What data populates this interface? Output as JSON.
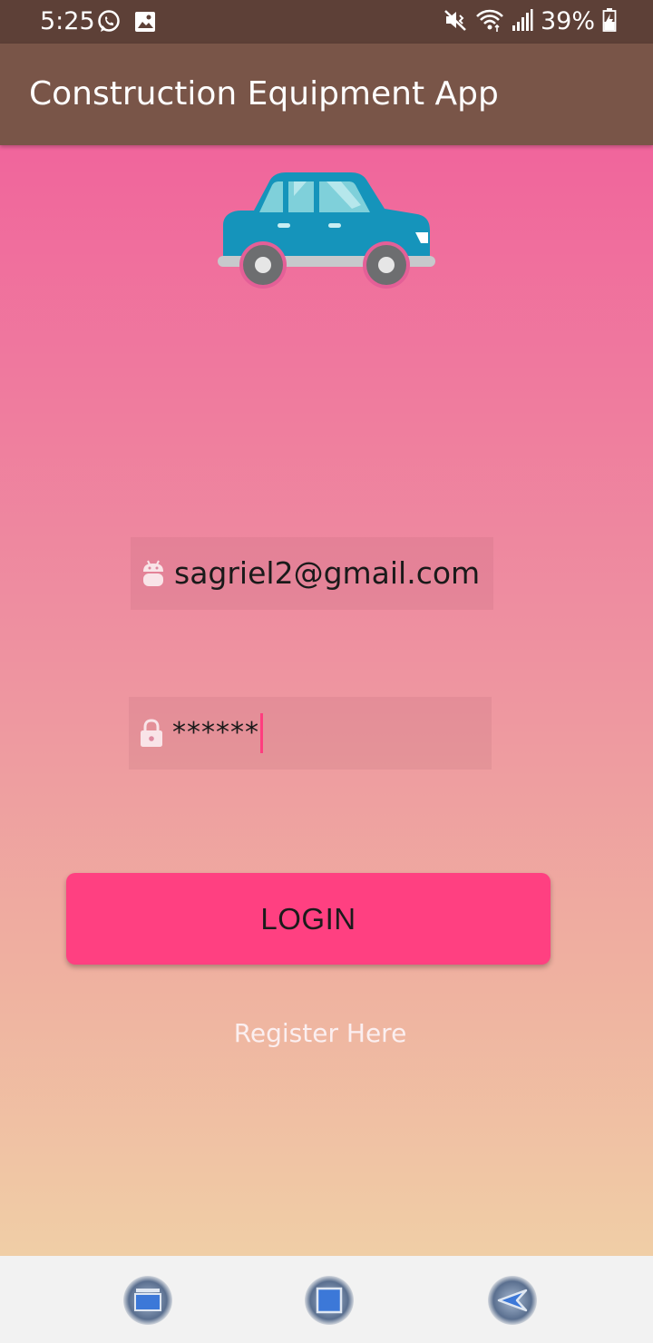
{
  "status_bar": {
    "time": "5:25",
    "battery": "39%",
    "left_icons": [
      "whatsapp-icon",
      "gallery-icon"
    ],
    "right_icons": [
      "mute-icon",
      "wifi-icon",
      "signal-icon",
      "battery-charging-icon"
    ]
  },
  "app_bar": {
    "title": "Construction Equipment App"
  },
  "login_form": {
    "logo_icon": "car-icon",
    "email": {
      "icon": "android-icon",
      "value": "sagriel2@gmail.com"
    },
    "password": {
      "icon": "lock-icon",
      "value": "******"
    },
    "login_label": "LOGIN",
    "register_label": "Register Here"
  },
  "nav_bar": {
    "buttons": [
      "recent-apps-icon",
      "home-icon",
      "back-icon"
    ]
  },
  "colors": {
    "status_bar": "#5d4037",
    "app_bar": "#795548",
    "accent": "#ff4081",
    "gradient_top": "#f0659c",
    "gradient_bottom": "#f0cea6"
  }
}
